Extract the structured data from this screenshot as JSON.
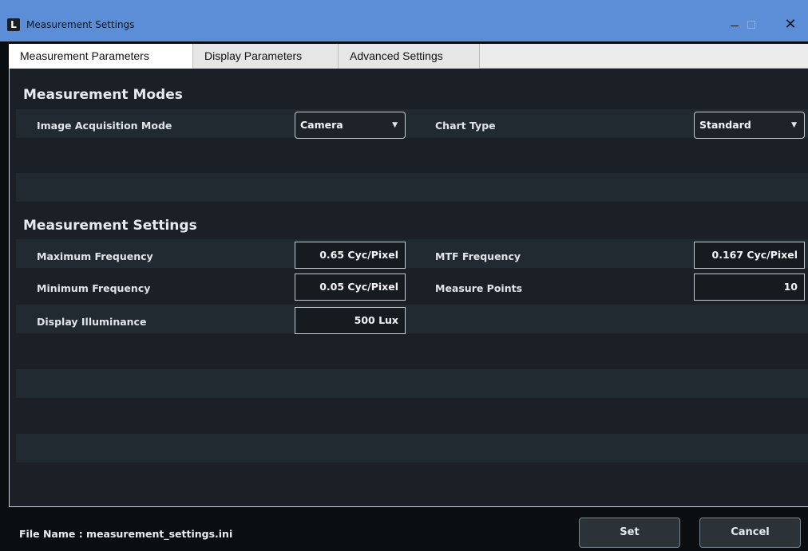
{
  "window": {
    "title": "Measurement Settings",
    "logo_letter": "L",
    "controls": {
      "minimize": "–",
      "maximize": "□",
      "close": "✕"
    }
  },
  "tabs": [
    {
      "label": "Measurement Parameters",
      "active": true
    },
    {
      "label": "Display Parameters",
      "active": false
    },
    {
      "label": "Advanced Settings",
      "active": false
    }
  ],
  "modes": {
    "title": "Measurement Modes",
    "image_acquisition_label": "Image Acquisition Mode",
    "image_acquisition_value": "Camera",
    "chart_type_label": "Chart Type",
    "chart_type_value": "Standard"
  },
  "settings": {
    "title": "Measurement Settings",
    "max_freq_label": "Maximum Frequency",
    "max_freq_value": "0.65 Cyc/Pixel",
    "mtf_freq_label": "MTF Frequency",
    "mtf_freq_value": "0.167 Cyc/Pixel",
    "min_freq_label": "Minimum Frequency",
    "min_freq_value": "0.05 Cyc/Pixel",
    "measure_points_label": "Measure Points",
    "measure_points_value": "10",
    "illuminance_label": "Display Illuminance",
    "illuminance_value": "500 Lux"
  },
  "footer": {
    "file_label": "File Name :  measurement_settings.ini",
    "set_label": "Set",
    "cancel_label": "Cancel"
  },
  "colors": {
    "titlebar": "#5b8ed6",
    "panel": "#1a2026",
    "row_alt": "#222a31"
  }
}
